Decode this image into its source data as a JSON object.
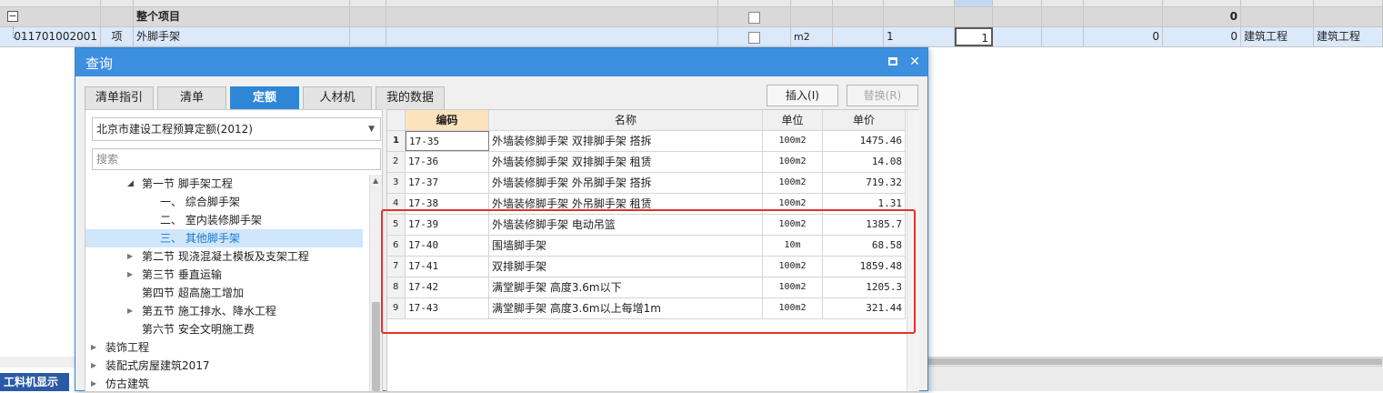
{
  "bg": {
    "group_row": {
      "label": "整个项目",
      "total": "0",
      "expander": "−"
    },
    "item_row": {
      "code": "011701002001",
      "kind": "项",
      "name": "外脚手架",
      "unit": "m2",
      "qty_expr": "1",
      "qty": "1",
      "price": "0",
      "total": "0",
      "category1": "建筑工程",
      "category2": "建筑工程"
    },
    "bottom_tab": "工料机显示"
  },
  "dialog": {
    "title": "查询",
    "maximize_icon": "maximize-icon",
    "close_glyph": "✕",
    "tabs": [
      {
        "label": "清单指引"
      },
      {
        "label": "清单"
      },
      {
        "label": "定额"
      },
      {
        "label": "人材机"
      },
      {
        "label": "我的数据"
      }
    ],
    "insert_button": "插入(I)",
    "replace_button": "替换(R)",
    "quota_library": "北京市建设工程预算定额(2012)",
    "search_placeholder": "搜索",
    "tree": [
      {
        "label": "第一节 脚手架工程"
      },
      {
        "label": "一、 综合脚手架"
      },
      {
        "label": "二、 室内装修脚手架"
      },
      {
        "label": "三、 其他脚手架"
      },
      {
        "label": "第二节 现浇混凝土模板及支架工程"
      },
      {
        "label": "第三节 垂直运输"
      },
      {
        "label": "第四节 超高施工增加"
      },
      {
        "label": "第五节 施工排水、降水工程"
      },
      {
        "label": "第六节 安全文明施工费"
      },
      {
        "label": "装饰工程"
      },
      {
        "label": "装配式房屋建筑2017"
      },
      {
        "label": "仿古建筑"
      }
    ],
    "table": {
      "headers": {
        "code": "编码",
        "name": "名称",
        "unit": "单位",
        "price": "单价"
      },
      "rows": [
        {
          "idx": "1",
          "code": "17-35",
          "name": "外墙装修脚手架 双排脚手架 搭拆",
          "unit": "100m2",
          "price": "1475.46"
        },
        {
          "idx": "2",
          "code": "17-36",
          "name": "外墙装修脚手架 双排脚手架 租赁",
          "unit": "100m2",
          "price": "14.08"
        },
        {
          "idx": "3",
          "code": "17-37",
          "name": "外墙装修脚手架 外吊脚手架 搭拆",
          "unit": "100m2",
          "price": "719.32"
        },
        {
          "idx": "4",
          "code": "17-38",
          "name": "外墙装修脚手架 外吊脚手架 租赁",
          "unit": "100m2",
          "price": "1.31"
        },
        {
          "idx": "5",
          "code": "17-39",
          "name": "外墙装修脚手架 电动吊篮",
          "unit": "100m2",
          "price": "1385.7"
        },
        {
          "idx": "6",
          "code": "17-40",
          "name": "围墙脚手架",
          "unit": "10m",
          "price": "68.58"
        },
        {
          "idx": "7",
          "code": "17-41",
          "name": "双排脚手架",
          "unit": "100m2",
          "price": "1859.48"
        },
        {
          "idx": "8",
          "code": "17-42",
          "name": "满堂脚手架 高度3.6m以下",
          "unit": "100m2",
          "price": "1205.3"
        },
        {
          "idx": "9",
          "code": "17-43",
          "name": "满堂脚手架 高度3.6m以上每增1m",
          "unit": "100m2",
          "price": "321.44"
        }
      ]
    }
  },
  "colors": {
    "titlebar": "#3d8fe0",
    "active_tab": "#2f86d6",
    "highlight_box": "#e5312d",
    "code_header": "#fbe3bd"
  }
}
